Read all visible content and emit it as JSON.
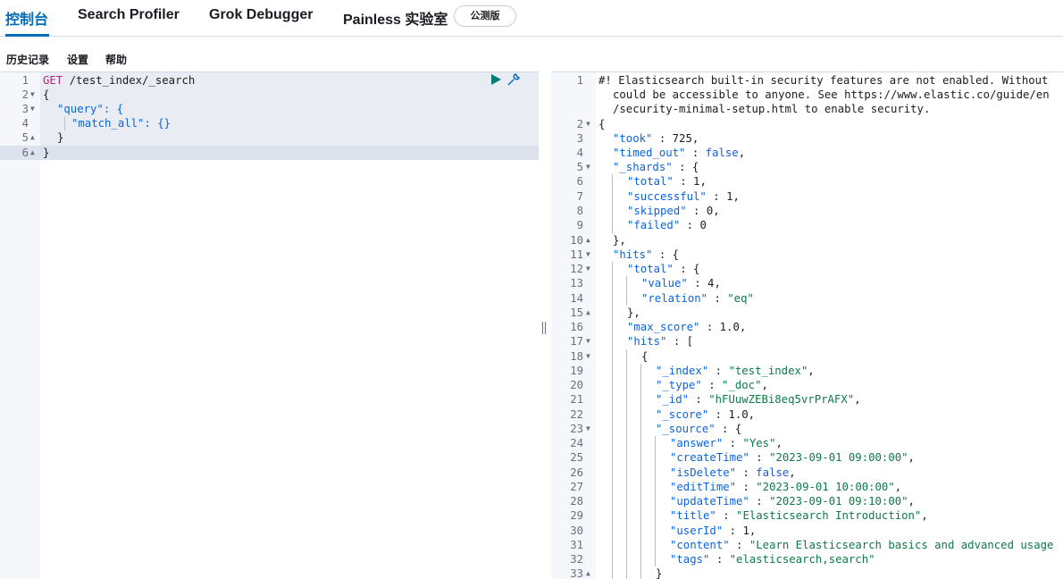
{
  "tabs": [
    {
      "label": "控制台",
      "active": true
    },
    {
      "label": "Search Profiler",
      "active": false
    },
    {
      "label": "Grok Debugger",
      "active": false
    },
    {
      "label": "Painless 实验室",
      "active": false
    }
  ],
  "beta_badge": "公测版",
  "menu": {
    "history": "历史记录",
    "settings": "设置",
    "help": "帮助"
  },
  "colors": {
    "accent": "#006bb8",
    "method": "#b3237e",
    "string": "#0d7a48",
    "boolean": "#1e5ad7",
    "error": "#e34d3c"
  },
  "request": {
    "method": "GET",
    "url": "/test_index/_search",
    "line_numbers": [
      "1",
      "2",
      "3",
      "4",
      "5",
      "6"
    ],
    "lines": [
      "{",
      "\"query\": {",
      "\"match_all\": {}",
      "}",
      "}"
    ]
  },
  "response": {
    "warning": [
      "#! Elasticsearch built-in security features are not enabled. Without",
      "could be accessible to anyone. See https://www.elastic.co/guide/en",
      "/security-minimal-setup.html to enable security."
    ],
    "line_numbers": [
      "1",
      "2",
      "3",
      "4",
      "5",
      "6",
      "7",
      "8",
      "9",
      "10",
      "11",
      "12",
      "13",
      "14",
      "15",
      "16",
      "17",
      "18",
      "19",
      "20",
      "21",
      "22",
      "23",
      "24",
      "25",
      "26",
      "27",
      "28",
      "29",
      "30",
      "31",
      "32",
      "33"
    ],
    "body": {
      "took_key": "\"took\"",
      "took": "725",
      "timed_out_key": "\"timed_out\"",
      "timed_out": "false",
      "shards_key": "\"_shards\"",
      "total_key": "\"total\"",
      "shards_total": "1",
      "successful_key": "\"successful\"",
      "successful": "1",
      "skipped_key": "\"skipped\"",
      "skipped": "0",
      "failed_key": "\"failed\"",
      "failed": "0",
      "hits_key": "\"hits\"",
      "value_key": "\"value\"",
      "value": "4",
      "relation_key": "\"relation\"",
      "relation": "\"eq\"",
      "max_score_key": "\"max_score\"",
      "max_score": "1.0",
      "index_key": "\"_index\"",
      "index": "\"test_index\"",
      "type_key": "\"_type\"",
      "type": "\"_doc\"",
      "id_key": "\"_id\"",
      "id": "\"hFUuwZEBi8eq5vrPrAFX\"",
      "score_key": "\"_score\"",
      "score": "1.0",
      "source_key": "\"_source\"",
      "answer_key": "\"answer\"",
      "answer": "\"Yes\"",
      "createTime_key": "\"createTime\"",
      "createTime": "\"2023-09-01 09:00:00\"",
      "isDelete_key": "\"isDelete\"",
      "isDelete": "false",
      "editTime_key": "\"editTime\"",
      "editTime": "\"2023-09-01 10:00:00\"",
      "updateTime_key": "\"updateTime\"",
      "updateTime": "\"2023-09-01 09:10:00\"",
      "title_key": "\"title\"",
      "title": "\"Elasticsearch Introduction\"",
      "userId_key": "\"userId\"",
      "userId": "1",
      "content_key": "\"content\"",
      "content": "\"Learn Elasticsearch basics and advanced usage",
      "tags_key": "\"tags\"",
      "tags": "\"elasticsearch,search\""
    }
  }
}
